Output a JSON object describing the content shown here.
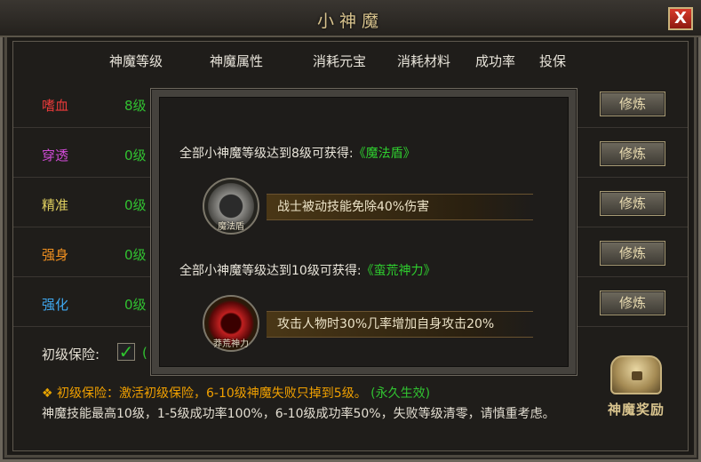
{
  "window": {
    "title": "小神魔",
    "close_label": "X"
  },
  "headers": [
    "神魔等级",
    "神魔属性",
    "消耗元宝",
    "消耗材料",
    "成功率",
    "投保"
  ],
  "rows": [
    {
      "name": "嗜血",
      "level": "8级",
      "color": "#e83a3a",
      "button": "修炼"
    },
    {
      "name": "穿透",
      "level": "0级",
      "color": "#d04bd6",
      "button": "修炼"
    },
    {
      "name": "精准",
      "level": "0级",
      "color": "#e0d060",
      "button": "修炼"
    },
    {
      "name": "强身",
      "level": "0级",
      "color": "#f09020",
      "button": "修炼"
    },
    {
      "name": "强化",
      "level": "0级",
      "color": "#3fa8f0",
      "button": "修炼"
    }
  ],
  "insurance": {
    "label": "初级保险:",
    "checked": true,
    "after": "("
  },
  "tip": {
    "bullet": "❖",
    "text": "初级保险：激活初级保险，6-10级神魔失败只掉到5级。",
    "permanent": "(永久生效)"
  },
  "description": "神魔技能最高10级，1-5级成功率100%，6-10级成功率50%，失败等级清零，请慎重考虑。",
  "reward": {
    "label": "神魔奖励"
  },
  "popup": {
    "unlock1": {
      "prefix": "全部小神魔等级达到8级可获得:",
      "name": "《魔法盾》"
    },
    "skill1": {
      "icon_label": "魔法盾",
      "effect": "战士被动技能免除40%伤害"
    },
    "unlock2": {
      "prefix": "全部小神魔等级达到10级可获得:",
      "name": "《蛮荒神力》"
    },
    "skill2": {
      "icon_label": "莽荒神力",
      "effect": "攻击人物时30%几率增加自身攻击20%"
    }
  }
}
